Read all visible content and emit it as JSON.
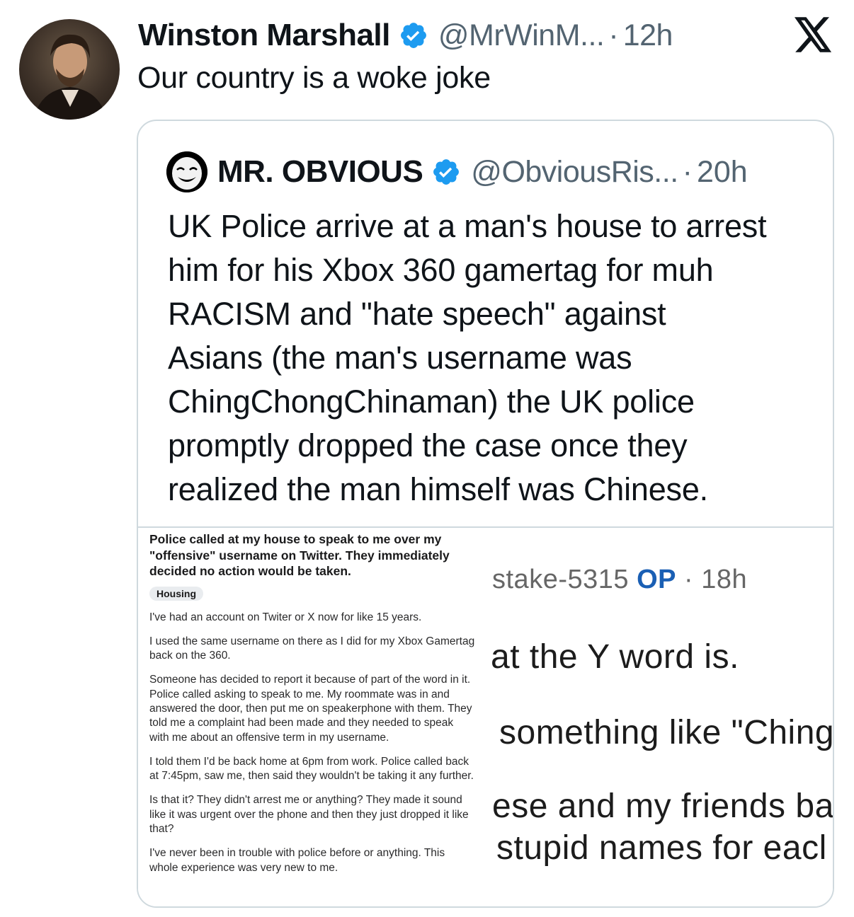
{
  "tweet": {
    "author_name": "Winston Marshall",
    "handle": "@MrWinM...",
    "separator": "·",
    "time": "12h",
    "text": "Our country is a woke joke"
  },
  "quoted_tweet": {
    "author_name": "MR. OBVIOUS",
    "handle": "@ObviousRis...",
    "separator": "·",
    "time": "20h",
    "text_lines": [
      "UK Police arrive at a man's house to arrest",
      "him for his Xbox 360 gamertag for muh",
      "RACISM and \"hate speech\" against",
      "Asians (the man's username was",
      "ChingChongChinaman) the UK police",
      "promptly dropped the case once they",
      "realized the man himself was Chinese."
    ]
  },
  "media": {
    "post_title": "Police called at my house to speak to me over my \"offensive\" username on Twitter. They immediately decided no action would be taken.",
    "flair": "Housing",
    "paragraphs": [
      "I've had an account on Twiter or X now for like 15 years.",
      "I used the same username on there as I did for my Xbox Gamertag back on the 360.",
      "Someone has decided to report it because of part of the word in it. Police called asking to speak to me. My roommate was in and answered the door, then put me on speakerphone with them. They told me a complaint had been made and they needed to speak with me about an offensive term in my username.",
      "I told them I'd be back home at 6pm from work. Police called back at 7:45pm, saw me, then said they wouldn't be taking it any further.",
      "Is that it? They didn't arrest me or anything? They made it sound like it was urgent over the phone and then they just dropped it like that?",
      "I've never been in trouble with police before or anything. This whole experience was very new to me."
    ],
    "comment_user": "stake-5315",
    "comment_op": "OP",
    "comment_separator": "·",
    "comment_time": "18h",
    "comment_lines": [
      "at the Y word is.",
      "something like \"Ching",
      "ese and my friends ba",
      "stupid names for eacl"
    ]
  },
  "icons": {
    "verified": "verified-badge-icon",
    "brand": "x-logo-icon"
  },
  "colors": {
    "verified": "#1d9bf0",
    "secondary_text": "#536471",
    "border": "#cfd9de",
    "op_blue": "#1a5fb4"
  }
}
